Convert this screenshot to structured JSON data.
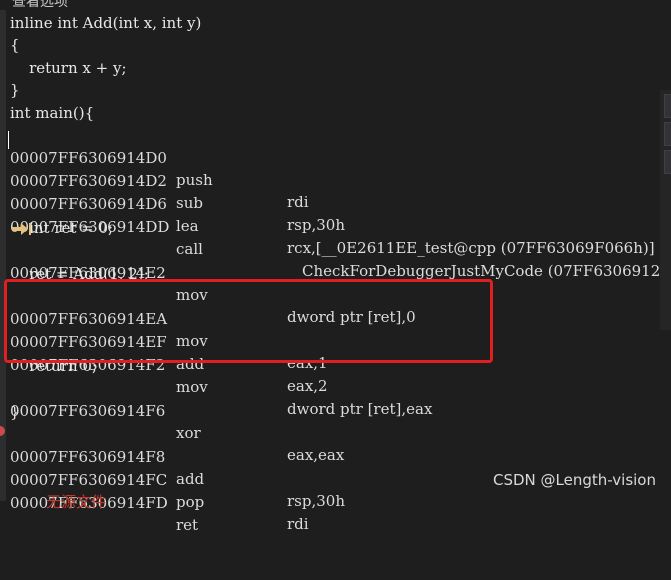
{
  "window": {
    "top_label": "查看选项"
  },
  "source_lines": {
    "l1": "inline int Add(int x, int y)",
    "l2": "{",
    "l3": "    return x + y;",
    "l4": "}",
    "l5": "int main(){",
    "l10": "    int ret = 0;",
    "l12": "    ret = Add(1, 2);",
    "l16": "    return 0;",
    "l18": "}"
  },
  "disasm": [
    {
      "addr": "00007FF6306914D0",
      "op": "push",
      "arg": "rdi"
    },
    {
      "addr": "00007FF6306914D2",
      "op": "sub",
      "arg": "rsp,30h"
    },
    {
      "addr": "00007FF6306914D6",
      "op": "lea",
      "arg": "rcx,[__0E2611EE_test@cpp (07FF63069F066h)]"
    },
    {
      "addr": "00007FF6306914DD",
      "op": "call",
      "arg": "__CheckForDebuggerJustMyCode (07FF6306912"
    },
    {
      "addr": "00007FF6306914E2",
      "op": "mov",
      "arg": "dword ptr [ret],0"
    },
    {
      "addr": "00007FF6306914EA",
      "op": "mov",
      "arg": "eax,1"
    },
    {
      "addr": "00007FF6306914EF",
      "op": "add",
      "arg": "eax,2"
    },
    {
      "addr": "00007FF6306914F2",
      "op": "mov",
      "arg": "dword ptr [ret],eax"
    },
    {
      "addr": "00007FF6306914F6",
      "op": "xor",
      "arg": "eax,eax"
    },
    {
      "addr": "00007FF6306914F8",
      "op": "add",
      "arg": "rsp,30h"
    },
    {
      "addr": "00007FF6306914FC",
      "op": "pop",
      "arg": "rdi"
    },
    {
      "addr": "00007FF6306914FD",
      "op": "ret",
      "arg": ""
    }
  ],
  "footer": {
    "no_source": "无源文件"
  },
  "watermark": "CSDN @Length-vision",
  "colors": {
    "highlight": "#e02020",
    "breakpoint": "#c94b4b",
    "arrow": "#e5c07b"
  }
}
